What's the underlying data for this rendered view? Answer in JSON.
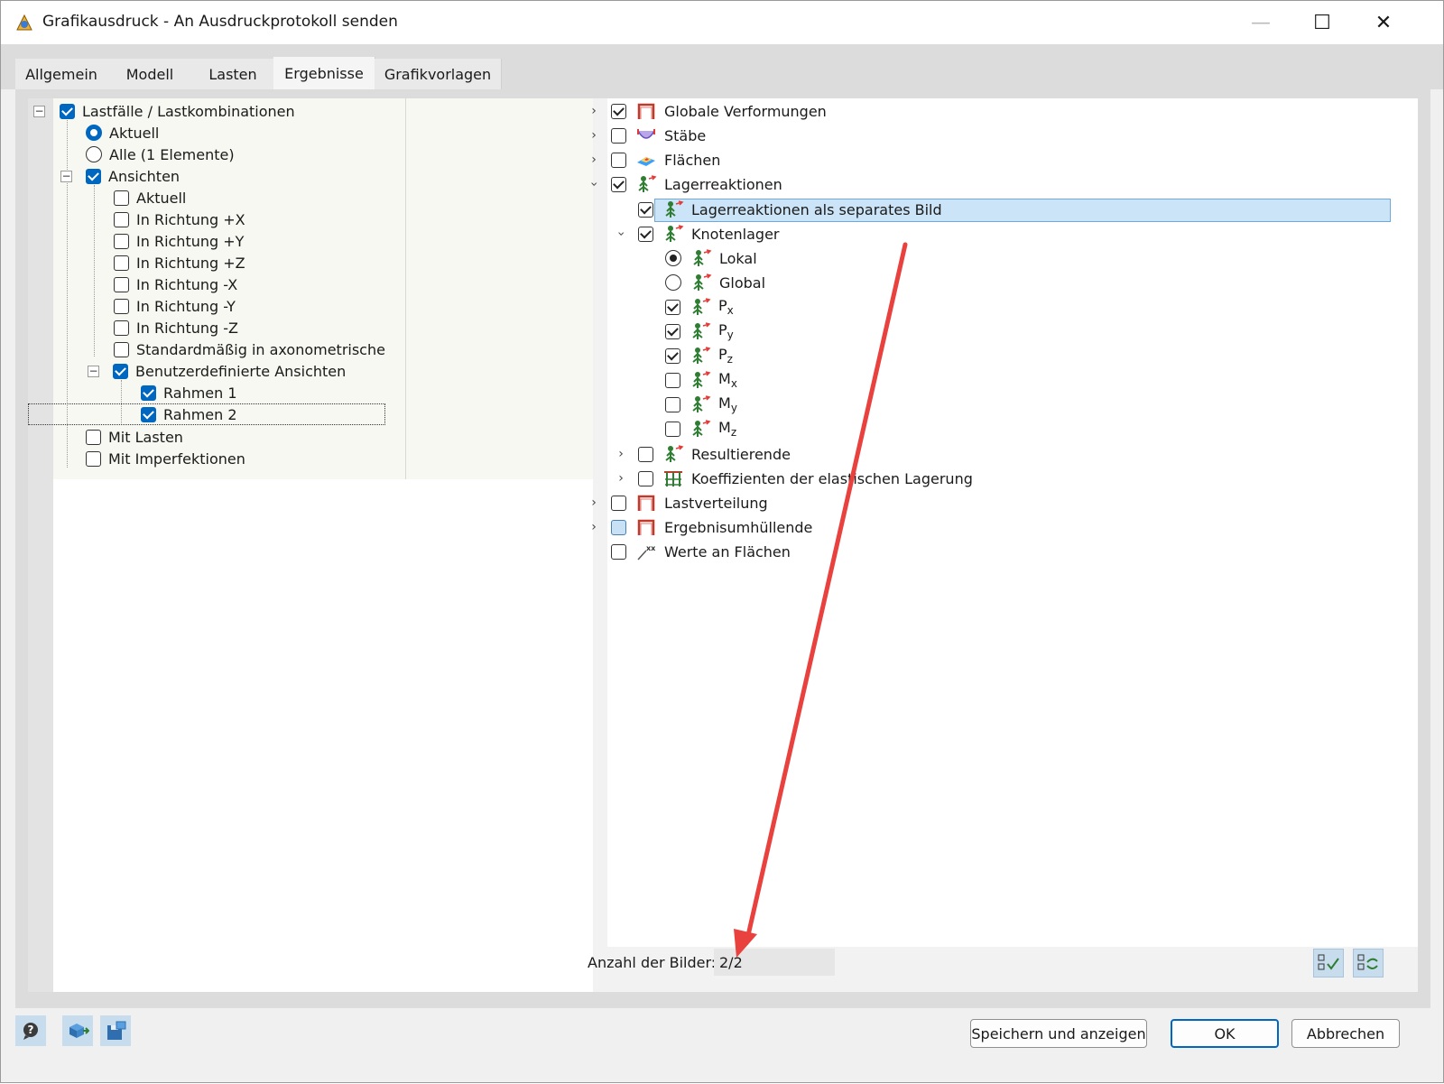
{
  "window": {
    "title": "Grafikausdruck - An Ausdruckprotokoll senden",
    "minimize": "—",
    "maximize": "☐",
    "close": "✕"
  },
  "tabs": [
    {
      "label": "Allgemein"
    },
    {
      "label": "Modell"
    },
    {
      "label": "Lasten"
    },
    {
      "label": "Ergebnisse",
      "active": true
    },
    {
      "label": "Grafikvorlagen"
    }
  ],
  "left_tree": {
    "lastfaelle": "Lastfälle / Lastkombinationen",
    "aktuell": "Aktuell",
    "alle": "Alle (1 Elemente)",
    "ansichten": "Ansichten",
    "view_aktuell": "Aktuell",
    "dir_px": "In Richtung +X",
    "dir_py": "In Richtung +Y",
    "dir_pz": "In Richtung +Z",
    "dir_mx": "In Richtung -X",
    "dir_my": "In Richtung -Y",
    "dir_mz": "In Richtung -Z",
    "standard": "Standardmäßig in axonometrischer F",
    "benutzer": "Benutzerdefinierte Ansichten",
    "rahmen1": "Rahmen 1",
    "rahmen2": "Rahmen 2",
    "mit_lasten": "Mit Lasten",
    "mit_imperf": "Mit Imperfektionen"
  },
  "right_tree": {
    "globale": "Globale Verformungen",
    "staebe": "Stäbe",
    "flaechen": "Flächen",
    "lagerreaktionen": "Lagerreaktionen",
    "separates": "Lagerreaktionen als separates Bild",
    "knotenlager": "Knotenlager",
    "lokal": "Lokal",
    "global": "Global",
    "px_main": "P",
    "px_sub": "x",
    "py_main": "P",
    "py_sub": "y",
    "pz_main": "P",
    "pz_sub": "z",
    "mx_main": "M",
    "mx_sub": "x",
    "my_main": "M",
    "my_sub": "y",
    "mz_main": "M",
    "mz_sub": "z",
    "resultierende": "Resultierende",
    "koeffizienten": "Koeffizienten der elastischen Lagerung",
    "lastverteilung": "Lastverteilung",
    "ergebnisumh": "Ergebnisumhüllende",
    "werte": "Werte an Flächen"
  },
  "anzahl": {
    "label": "Anzahl der Bilder:",
    "value": "2/2"
  },
  "buttons": {
    "speichern": "Speichern und anzeigen",
    "ok": "OK",
    "abbrechen": "Abbrechen"
  },
  "colors": {
    "accent": "#0067c0",
    "annotation_arrow": "#e8413e",
    "selection": "#cce4f7"
  },
  "icons": [
    "app-icon",
    "help-icon",
    "cube-export-icon",
    "save-settings-icon",
    "check-all-icon",
    "uncheck-all-icon",
    "frame-result-icon",
    "member-result-icon",
    "surface-result-icon",
    "support-reaction-icon",
    "elastic-support-icon",
    "values-on-surfaces-icon"
  ]
}
